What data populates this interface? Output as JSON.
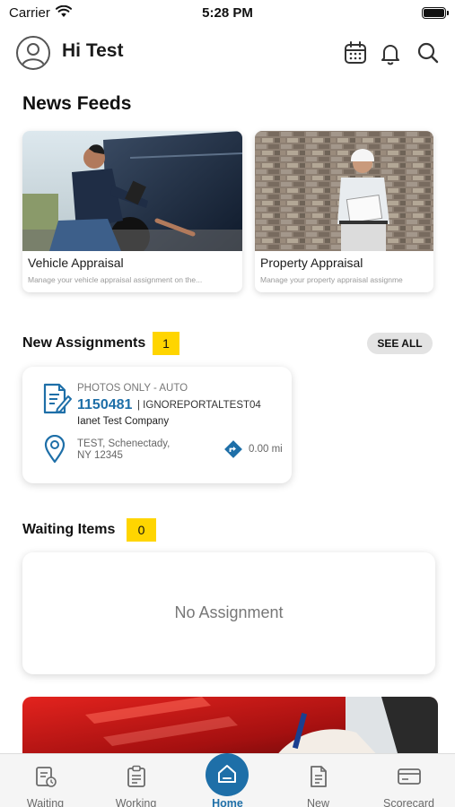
{
  "status_bar": {
    "carrier": "Carrier",
    "time": "5:28 PM"
  },
  "header": {
    "greeting": "Hi Test"
  },
  "news_feeds": {
    "title": "News Feeds",
    "cards": [
      {
        "title": "Vehicle Appraisal",
        "subtitle": "Manage your vehicle appraisal assignment on the..."
      },
      {
        "title": "Property Appraisal",
        "subtitle": "Manage your property appraisal assignme"
      }
    ]
  },
  "new_assignments": {
    "title": "New Assignments",
    "count": "1",
    "see_all_label": "SEE ALL",
    "card": {
      "type": "PHOTOS ONLY - AUTO",
      "number": "1150481",
      "code": "| IGNOREPORTALTEST04",
      "company": "Ianet Test Company",
      "address_line1": "TEST, Schenectady,",
      "address_line2": "NY 12345",
      "distance": "0.00 mi"
    }
  },
  "waiting_items": {
    "title": "Waiting Items",
    "count": "0",
    "empty_text": "No Assignment"
  },
  "tabbar": {
    "tabs": [
      {
        "label": "Waiting",
        "icon": "waiting-icon"
      },
      {
        "label": "Working",
        "icon": "clipboard-icon"
      },
      {
        "label": "Home",
        "icon": "home-icon"
      },
      {
        "label": "New",
        "icon": "new-document-icon"
      },
      {
        "label": "Scorecard",
        "icon": "scorecard-icon"
      }
    ]
  },
  "colors": {
    "accent": "#1e6fa8",
    "badge": "#ffd500"
  }
}
